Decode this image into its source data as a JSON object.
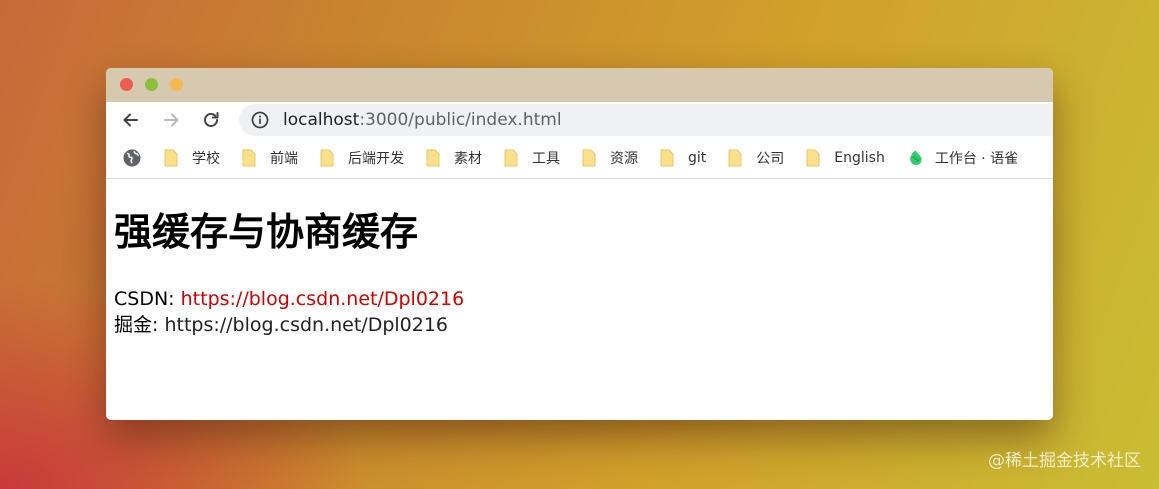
{
  "browser": {
    "url_host": "localhost",
    "url_path": ":3000/public/index.html",
    "bookmarks": [
      "学校",
      "前端",
      "后端开发",
      "素材",
      "工具",
      "资源",
      "git",
      "公司",
      "English"
    ],
    "bookmark_app": "工作台 · 语雀"
  },
  "page": {
    "heading": "强缓存与协商缓存",
    "csdn_label": "CSDN: ",
    "csdn_link": "https://blog.csdn.net/Dpl0216",
    "juejin_label": "掘金: ",
    "juejin_text": "https://blog.csdn.net/Dpl0216"
  },
  "watermark": "@稀土掘金技术社区",
  "colors": {
    "link": "#cc0000",
    "traffic_red": "#ee5c52",
    "traffic_yellow": "#8bbf3c",
    "traffic_green": "#f3b950"
  }
}
